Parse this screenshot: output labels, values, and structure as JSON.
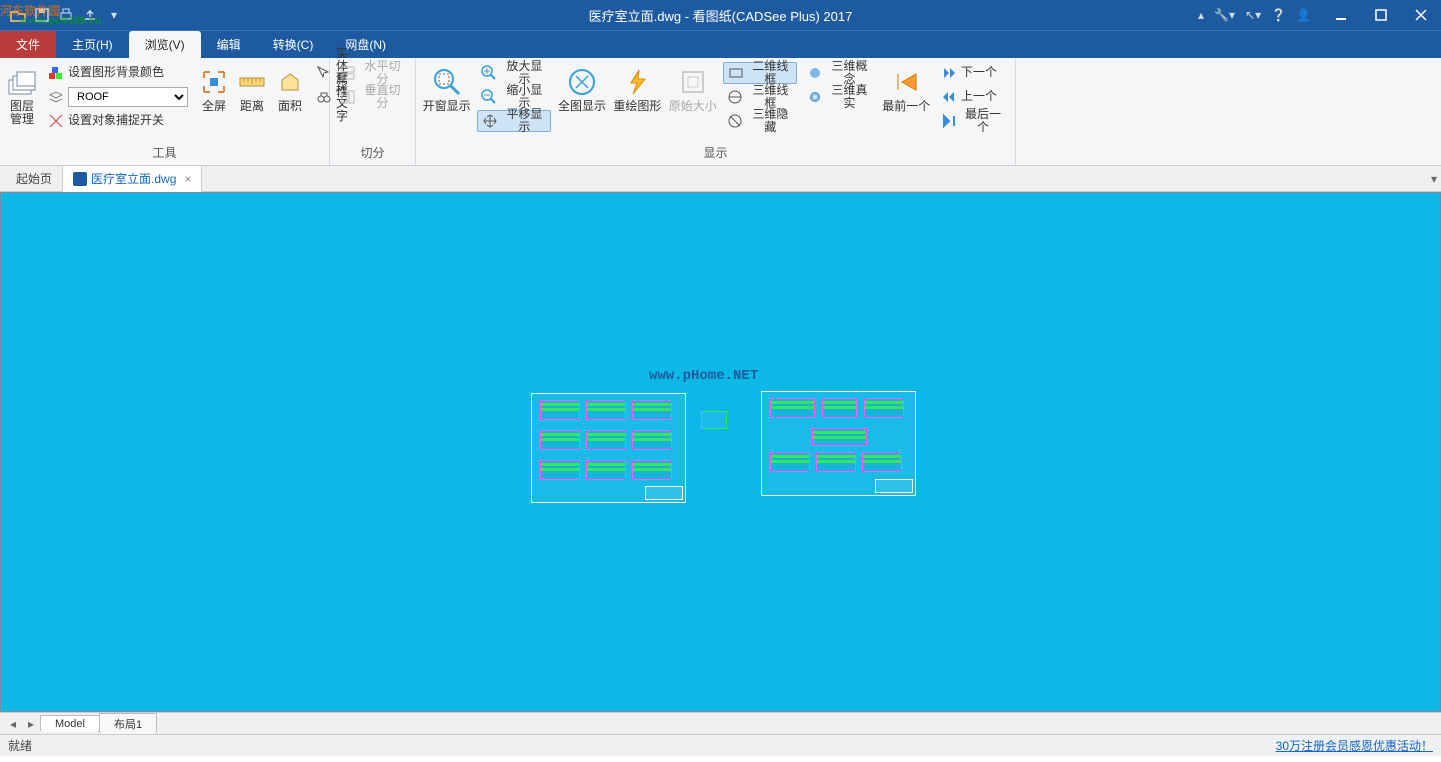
{
  "title": "医疗室立面.dwg - 看图纸(CADSee Plus) 2017",
  "watermark": {
    "main": "河东软件园",
    "sub": "www.pc0359.cn"
  },
  "menubar": {
    "file": "文件",
    "items": [
      {
        "label": "主页(H)"
      },
      {
        "label": "浏览(V)",
        "active": true
      },
      {
        "label": "编辑"
      },
      {
        "label": "转换(C)"
      },
      {
        "label": "网盘(N)"
      }
    ]
  },
  "ribbon": {
    "layer_mgmt": "图层管理",
    "bg_color": "设置图形背景颜色",
    "layer_value": "ROOF",
    "osnap": "设置对象捕捉开关",
    "fullscreen": "全屏",
    "distance": "距离",
    "area": "面积",
    "entprops": "实体属性",
    "findtext": "查找文字",
    "hsplit": "水平切分",
    "vsplit": "垂直切分",
    "zoomwin": "开窗显示",
    "zoomin": "放大显示",
    "zoomout": "缩小显示",
    "pan": "平移显示",
    "zoomall": "全图显示",
    "regen": "重绘图形",
    "origsize": "原始大小",
    "wf2d": "二维线框",
    "wf3d": "三维线框",
    "hide3d": "三维隐藏",
    "concept3d": "三维概念",
    "real3d": "三维真实",
    "first": "最前一个",
    "next": "下一个",
    "prev": "上一个",
    "last": "最后一个",
    "grp_tools": "工具",
    "grp_split": "切分",
    "grp_display": "显示"
  },
  "doctabs": {
    "start": "起始页",
    "file": "医疗室立面.dwg"
  },
  "canvas": {
    "url_watermark": "www.pHome.NET"
  },
  "modeltabs": {
    "model": "Model",
    "layout1": "布局1"
  },
  "status": {
    "ready": "就绪",
    "promo": "30万注册会员感恩优惠活动！"
  }
}
